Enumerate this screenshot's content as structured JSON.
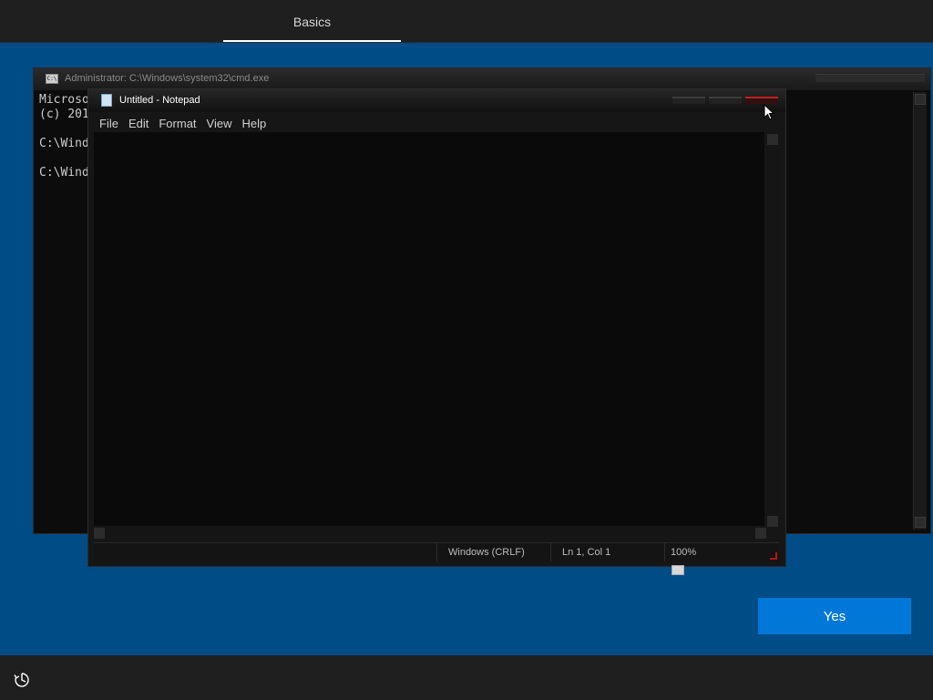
{
  "oobe": {
    "tab_label": "Basics",
    "yes_label": "Yes",
    "accessibility_icon": "accessibility-icon"
  },
  "cmd": {
    "title": "Administrator: C:\\Windows\\system32\\cmd.exe",
    "lines": [
      "Microso",
      "(c) 201",
      "",
      "C:\\Wind",
      "",
      "C:\\Wind"
    ]
  },
  "notepad": {
    "title": "Untitled - Notepad",
    "menu": [
      "File",
      "Edit",
      "Format",
      "View",
      "Help"
    ],
    "status": {
      "encoding": "Windows (CRLF)",
      "position": "Ln 1, Col 1",
      "zoom": "100%"
    }
  }
}
